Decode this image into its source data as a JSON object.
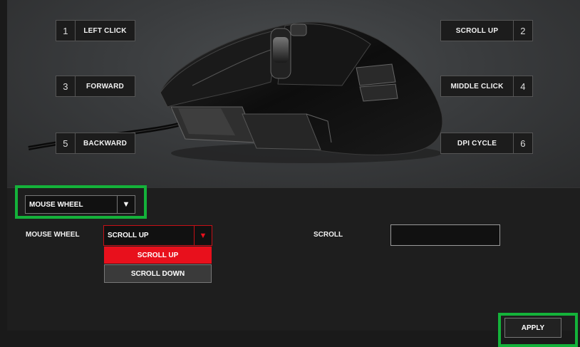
{
  "buttons": [
    {
      "num": "1",
      "label": "LEFT CLICK"
    },
    {
      "num": "2",
      "label": "SCROLL UP"
    },
    {
      "num": "3",
      "label": "FORWARD"
    },
    {
      "num": "4",
      "label": "MIDDLE CLICK"
    },
    {
      "num": "5",
      "label": "BACKWARD"
    },
    {
      "num": "6",
      "label": "DPI CYCLE"
    }
  ],
  "mode_select": {
    "value": "MOUSE WHEEL",
    "arrow": "▼"
  },
  "wheel_row": {
    "label": "MOUSE WHEEL",
    "select_value": "SCROLL UP",
    "arrow": "▼",
    "options": [
      "SCROLL UP",
      "SCROLL DOWN"
    ]
  },
  "scroll": {
    "label": "SCROLL",
    "value": ""
  },
  "apply_label": "APPLY",
  "colors": {
    "accent_red": "#e8101c",
    "highlight_green": "#14b23a"
  },
  "icons": {
    "mouse": "mouse-image",
    "dropdown": "triangle-down-icon"
  }
}
